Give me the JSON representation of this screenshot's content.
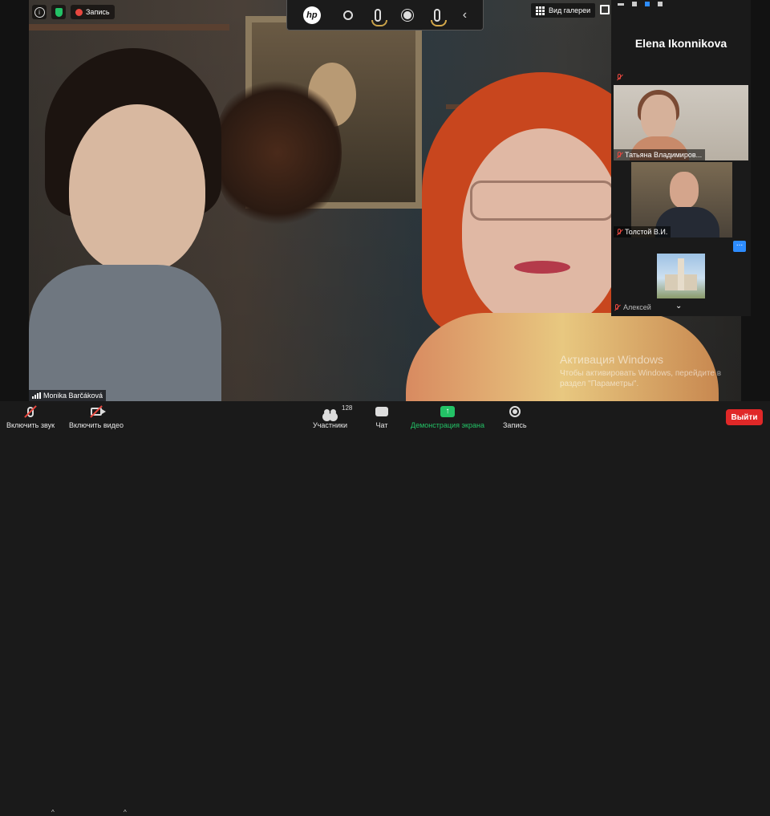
{
  "top_bar": {
    "record_label": "Запись",
    "gallery_label": "Вид галереи"
  },
  "main_video": {
    "participant_name": "Monika Barčáková"
  },
  "sidebar": {
    "active_speaker": "Elena Ikonnikova",
    "tiles": [
      {
        "name": "Татьяна Владимиров..."
      },
      {
        "name": "Толстой В.И."
      },
      {
        "name": "Алексей"
      }
    ],
    "more_label": "..."
  },
  "watermark": {
    "title": "Активация Windows",
    "subtitle": "Чтобы активировать Windows, перейдите в раздел \"Параметры\"."
  },
  "toolbar": {
    "mute_label": "Включить звук",
    "video_label": "Включить видео",
    "participants_label": "Участники",
    "participants_count": "128",
    "chat_label": "Чат",
    "share_label": "Демонстрация экрана",
    "record_label": "Запись",
    "leave_label": "Выйти"
  },
  "colors": {
    "accent_blue": "#2d8cff",
    "share_green": "#23c266",
    "leave_red": "#e02828",
    "muted_red": "#e8473f"
  }
}
